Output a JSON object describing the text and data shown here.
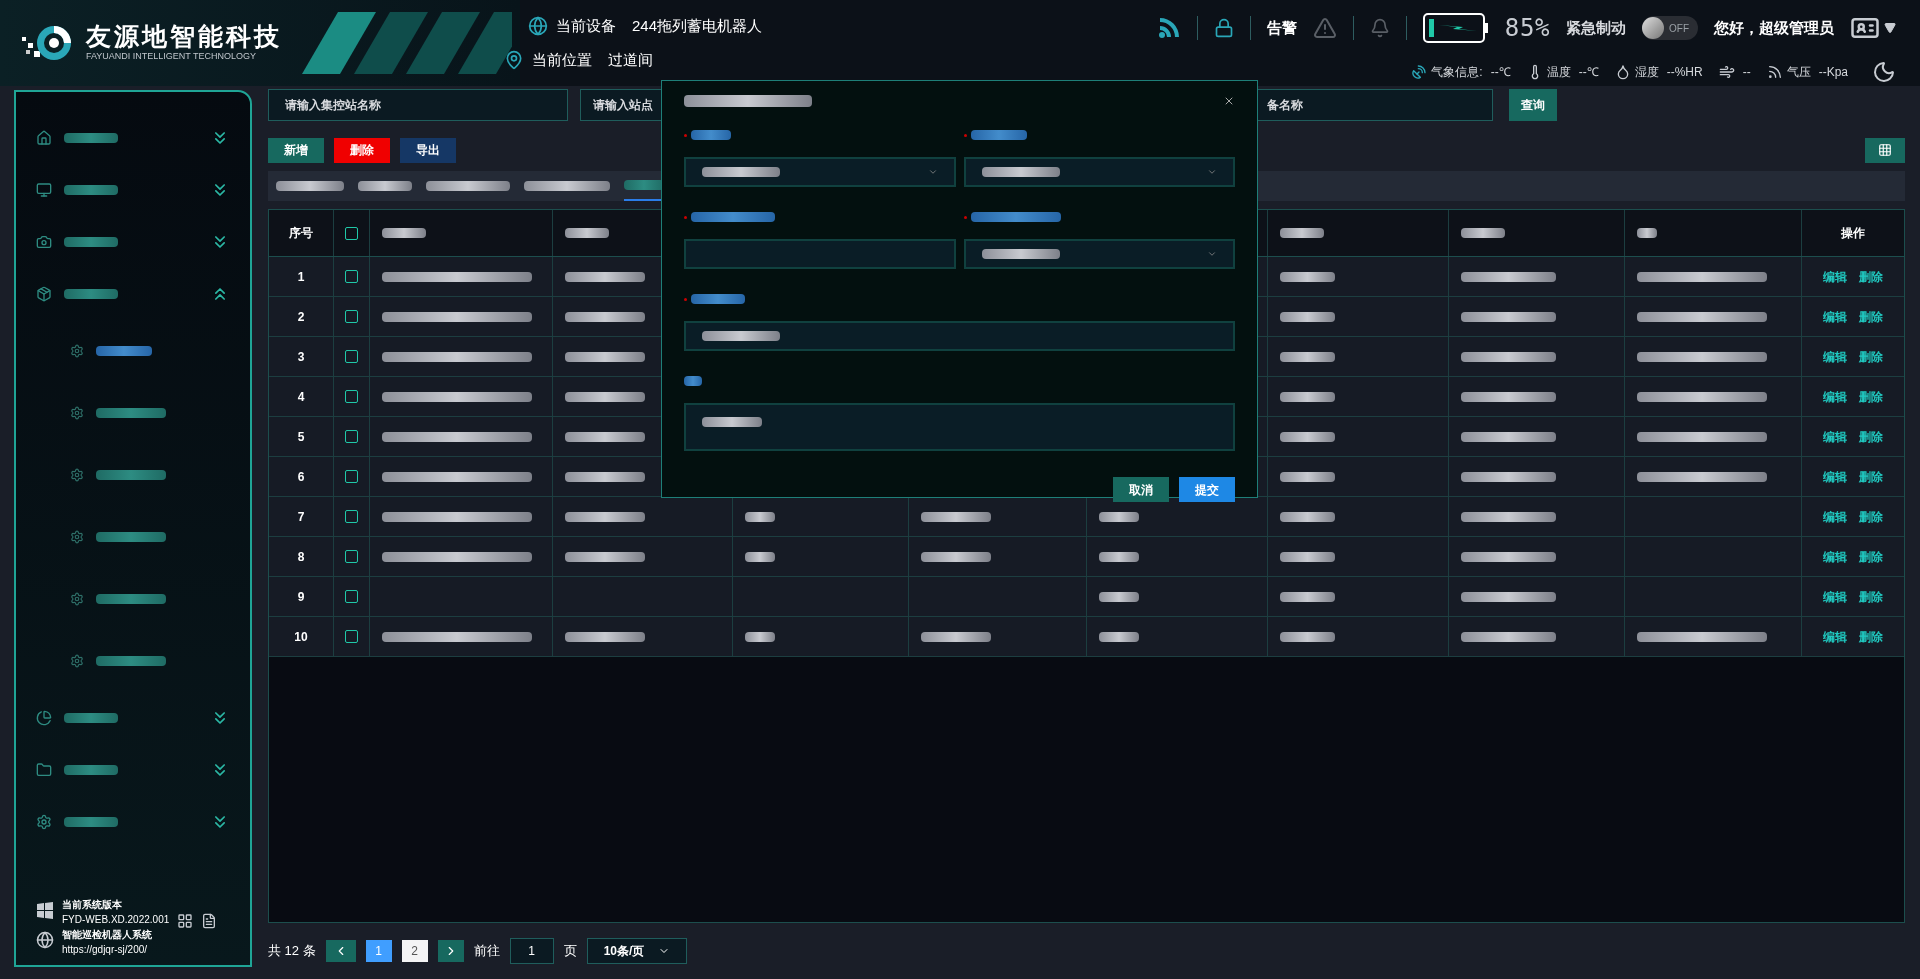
{
  "header": {
    "logo_title": "友源地智能科技",
    "logo_subtitle": "FAYUANDI INTELLIGENT TECHNOLOGY",
    "device_label": "当前设备",
    "device": "244拖列蓄电机器人",
    "location_label": "当前位置",
    "location": "过道间",
    "alarm_label": "告警",
    "battery_text": "85%",
    "emergency_label": "紧急制动",
    "toggle": {
      "label": "OFF",
      "on": false
    },
    "greeting": "您好，超级管理员"
  },
  "weather": [
    {
      "kind": "weather",
      "label": "气象信息:",
      "value": "--℃"
    },
    {
      "kind": "temperature",
      "label": "温度",
      "value": "--℃"
    },
    {
      "kind": "humidity",
      "label": "湿度",
      "value": "--%HR"
    },
    {
      "kind": "wind",
      "value": "--"
    },
    {
      "kind": "pressure",
      "label": "气压",
      "value": "--Kpa"
    }
  ],
  "sidebar": {
    "items": [
      {
        "kind": "home",
        "expanded": false
      },
      {
        "kind": "monitor",
        "expanded": false
      },
      {
        "kind": "camera",
        "expanded": false
      },
      {
        "kind": "box",
        "expanded": true,
        "children": [
          {
            "selected": true
          },
          {
            "selected": false
          },
          {
            "selected": false
          },
          {
            "selected": false
          },
          {
            "selected": false
          },
          {
            "selected": false
          }
        ]
      },
      {
        "kind": "chart",
        "expanded": false
      },
      {
        "kind": "folder",
        "expanded": false
      },
      {
        "kind": "gear",
        "expanded": false
      }
    ],
    "version_label": "当前系统版本",
    "version": "FYD-WEB.XD.2022.001",
    "system_name": "智能巡检机器人系统",
    "url": "https://gdjqr-sj/200/"
  },
  "filters": [
    {
      "placeholder": "请输入集控站名称"
    },
    {
      "placeholder": "请输入站点"
    },
    {
      "placeholder": "备名称"
    }
  ],
  "search_button": "查询",
  "actions": [
    {
      "kind": "add",
      "label": "新增"
    },
    {
      "kind": "delete",
      "label": "删除"
    },
    {
      "kind": "export",
      "label": "导出"
    }
  ],
  "tabs": [
    {
      "selected": false
    },
    {
      "selected": false
    },
    {
      "selected": false
    },
    {
      "selected": false
    },
    {
      "selected": true
    }
  ],
  "table": {
    "index_header": "序号",
    "action_header": "操作",
    "select_all_checked": false,
    "header_cells": [
      true,
      true,
      false,
      false,
      false,
      true,
      true,
      true
    ],
    "rows": [
      {
        "index": "1",
        "checked": false,
        "cells": [
          true,
          true,
          false,
          false,
          false,
          true,
          true,
          true
        ],
        "edit": "编辑",
        "delete": "删除"
      },
      {
        "index": "2",
        "checked": false,
        "cells": [
          true,
          true,
          false,
          false,
          false,
          true,
          true,
          true
        ],
        "edit": "编辑",
        "delete": "删除"
      },
      {
        "index": "3",
        "checked": false,
        "cells": [
          true,
          true,
          false,
          false,
          false,
          true,
          true,
          true
        ],
        "edit": "编辑",
        "delete": "删除"
      },
      {
        "index": "4",
        "checked": false,
        "cells": [
          true,
          true,
          false,
          false,
          false,
          true,
          true,
          true
        ],
        "edit": "编辑",
        "delete": "删除"
      },
      {
        "index": "5",
        "checked": false,
        "cells": [
          true,
          true,
          false,
          false,
          false,
          true,
          true,
          true
        ],
        "edit": "编辑",
        "delete": "删除"
      },
      {
        "index": "6",
        "checked": false,
        "cells": [
          true,
          true,
          false,
          false,
          false,
          true,
          true,
          true
        ],
        "edit": "编辑",
        "delete": "删除"
      },
      {
        "index": "7",
        "checked": false,
        "cells": [
          true,
          true,
          true,
          true,
          true,
          true,
          true,
          false
        ],
        "edit": "编辑",
        "delete": "删除"
      },
      {
        "index": "8",
        "checked": false,
        "cells": [
          true,
          true,
          true,
          true,
          true,
          true,
          true,
          false
        ],
        "edit": "编辑",
        "delete": "删除"
      },
      {
        "index": "9",
        "checked": false,
        "cells": [
          false,
          false,
          false,
          false,
          true,
          true,
          true,
          false
        ],
        "edit": "编辑",
        "delete": "删除"
      },
      {
        "index": "10",
        "checked": false,
        "cells": [
          true,
          true,
          true,
          true,
          true,
          true,
          true,
          true
        ],
        "edit": "编辑",
        "delete": "删除"
      }
    ]
  },
  "pagination": {
    "total": "共 12 条",
    "pages": [
      {
        "label": "1",
        "selected": true
      },
      {
        "label": "2",
        "selected": false
      }
    ],
    "goto_label": "前往",
    "goto_value": "1",
    "page_unit": "页",
    "page_size": "10条/页"
  },
  "dialog": {
    "rows": [
      [
        {
          "kind": "select",
          "required": true
        },
        {
          "kind": "select",
          "required": true
        }
      ],
      [
        {
          "kind": "input",
          "required": true,
          "filled": false
        },
        {
          "kind": "select",
          "required": true
        }
      ],
      [
        {
          "kind": "input",
          "required": true,
          "filled": true
        }
      ],
      [
        {
          "kind": "textarea",
          "required": false,
          "filled": true
        }
      ]
    ],
    "cancel": "取消",
    "submit": "提交"
  }
}
